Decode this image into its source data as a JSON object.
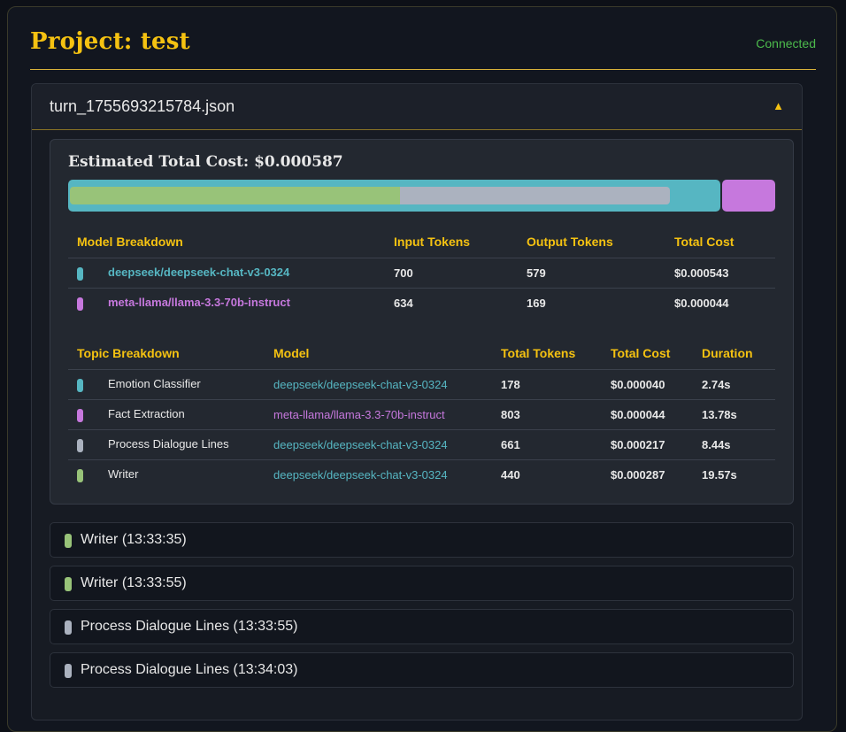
{
  "project_title": "Project: test",
  "connection_status": "Connected",
  "file": {
    "name": "turn_1755693215784.json",
    "toggle_glyph": "▲"
  },
  "cost": {
    "title": "Estimated Total Cost: $0.000587",
    "bar": {
      "total_cost": 0.000587,
      "segments": [
        {
          "model": "deepseek/deepseek-chat-v3-0324",
          "cost": 0.000543,
          "color": "#56b6c2",
          "input_share": 0.55,
          "output_share": 0.45
        },
        {
          "model": "meta-llama/llama-3.3-70b-instruct",
          "cost": 4.4e-05,
          "color": "#c678dd"
        }
      ]
    }
  },
  "model_table": {
    "headers": [
      "Model Breakdown",
      "Input Tokens",
      "Output Tokens",
      "Total Cost"
    ],
    "rows": [
      {
        "color": "#56b6c2",
        "model": "deepseek/deepseek-chat-v3-0324",
        "input": "700",
        "output": "579",
        "cost": "$0.000543"
      },
      {
        "color": "#c678dd",
        "model": "meta-llama/llama-3.3-70b-instruct",
        "input": "634",
        "output": "169",
        "cost": "$0.000044"
      }
    ]
  },
  "topic_table": {
    "headers": [
      "Topic Breakdown",
      "Model",
      "Total Tokens",
      "Total Cost",
      "Duration"
    ],
    "rows": [
      {
        "color": "#56b6c2",
        "topic": "Emotion Classifier",
        "model": "deepseek/deepseek-chat-v3-0324",
        "model_color": "#56b6c2",
        "tokens": "178",
        "cost": "$0.000040",
        "duration": "2.74s"
      },
      {
        "color": "#c678dd",
        "topic": "Fact Extraction",
        "model": "meta-llama/llama-3.3-70b-instruct",
        "model_color": "#c678dd",
        "tokens": "803",
        "cost": "$0.000044",
        "duration": "13.78s"
      },
      {
        "color": "#abb2bf",
        "topic": "Process Dialogue Lines",
        "model": "deepseek/deepseek-chat-v3-0324",
        "model_color": "#56b6c2",
        "tokens": "661",
        "cost": "$0.000217",
        "duration": "8.44s"
      },
      {
        "color": "#98c379",
        "topic": "Writer",
        "model": "deepseek/deepseek-chat-v3-0324",
        "model_color": "#56b6c2",
        "tokens": "440",
        "cost": "$0.000287",
        "duration": "19.57s"
      }
    ]
  },
  "entries": [
    {
      "label": "Writer (13:33:35)",
      "color": "#98c379"
    },
    {
      "label": "Writer (13:33:55)",
      "color": "#98c379"
    },
    {
      "label": "Process Dialogue Lines (13:33:55)",
      "color": "#abb2bf"
    },
    {
      "label": "Process Dialogue Lines (13:34:03)",
      "color": "#abb2bf"
    }
  ]
}
